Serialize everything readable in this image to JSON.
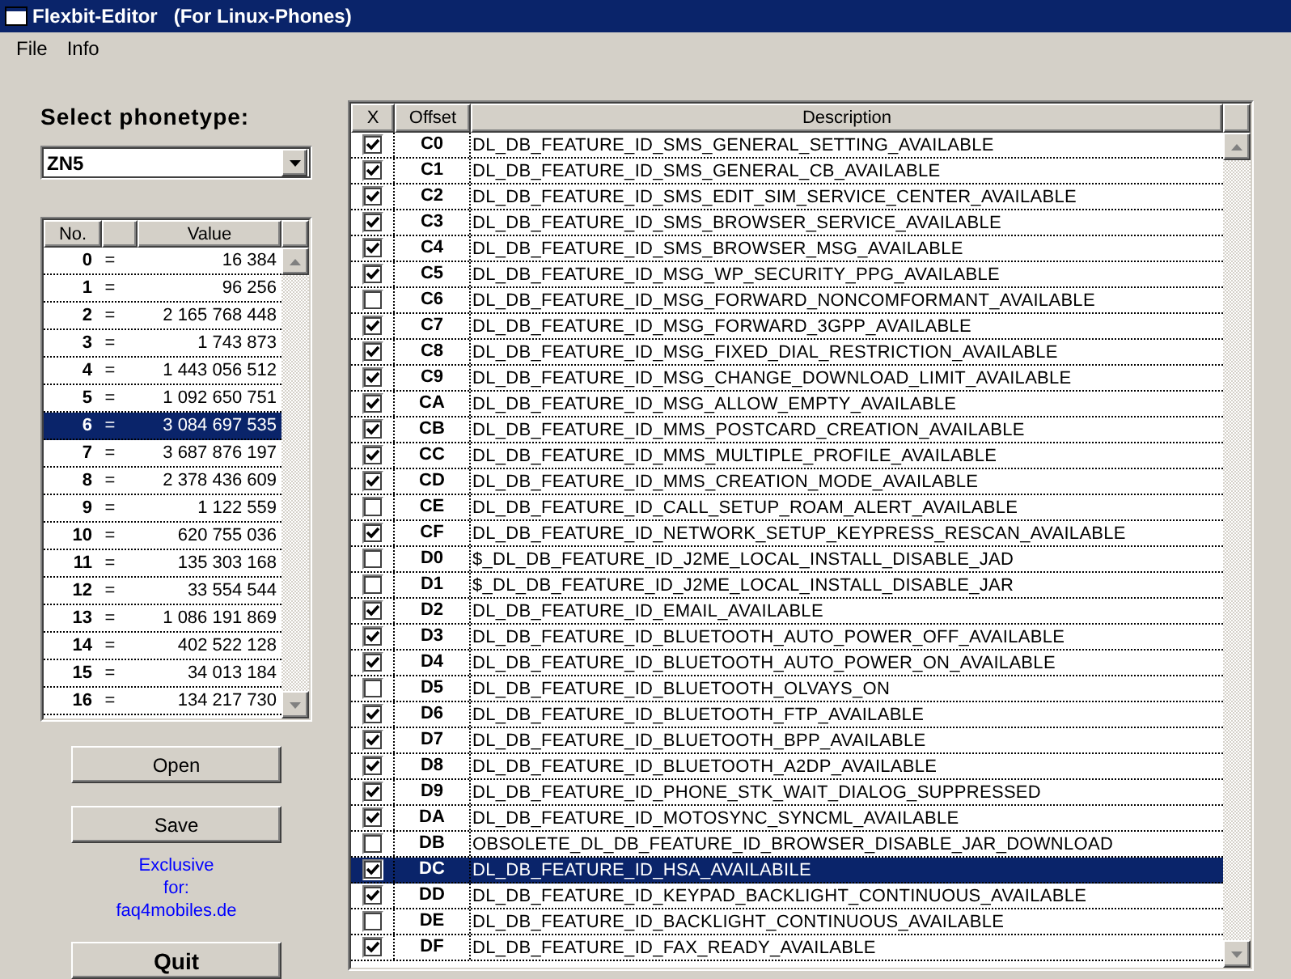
{
  "window": {
    "title": "Flexbit-Editor   (For Linux-Phones)"
  },
  "menu": [
    {
      "label": "File"
    },
    {
      "label": "Info"
    }
  ],
  "phonetype": {
    "label": "Select phonetype:",
    "value": "ZN5"
  },
  "values_table": {
    "columns": [
      "No.",
      "Value"
    ],
    "rows": [
      {
        "no": "0",
        "eq": "=",
        "value": "16 384",
        "selected": false
      },
      {
        "no": "1",
        "eq": "=",
        "value": "96 256",
        "selected": false
      },
      {
        "no": "2",
        "eq": "=",
        "value": "2 165 768 448",
        "selected": false
      },
      {
        "no": "3",
        "eq": "=",
        "value": "1 743 873",
        "selected": false
      },
      {
        "no": "4",
        "eq": "=",
        "value": "1 443 056 512",
        "selected": false
      },
      {
        "no": "5",
        "eq": "=",
        "value": "1 092 650 751",
        "selected": false
      },
      {
        "no": "6",
        "eq": "=",
        "value": "3 084 697 535",
        "selected": true
      },
      {
        "no": "7",
        "eq": "=",
        "value": "3 687 876 197",
        "selected": false
      },
      {
        "no": "8",
        "eq": "=",
        "value": "2 378 436 609",
        "selected": false
      },
      {
        "no": "9",
        "eq": "=",
        "value": "1 122 559",
        "selected": false
      },
      {
        "no": "10",
        "eq": "=",
        "value": "620 755 036",
        "selected": false
      },
      {
        "no": "11",
        "eq": "=",
        "value": "135 303 168",
        "selected": false
      },
      {
        "no": "12",
        "eq": "=",
        "value": "33 554 544",
        "selected": false
      },
      {
        "no": "13",
        "eq": "=",
        "value": "1 086 191 869",
        "selected": false
      },
      {
        "no": "14",
        "eq": "=",
        "value": "402 522 128",
        "selected": false
      },
      {
        "no": "15",
        "eq": "=",
        "value": "34 013 184",
        "selected": false
      },
      {
        "no": "16",
        "eq": "=",
        "value": "134 217 730",
        "selected": false
      }
    ]
  },
  "buttons": [
    {
      "label": "Open"
    },
    {
      "label": "Save"
    }
  ],
  "credit": [
    "Exclusive",
    "for:",
    "faq4mobiles.de"
  ],
  "quit": {
    "label": "Quit"
  },
  "features_table": {
    "columns": [
      "X",
      "Offset",
      "Description"
    ],
    "rows": [
      {
        "checked": true,
        "offset": "C0",
        "description": "DL_DB_FEATURE_ID_SMS_GENERAL_SETTING_AVAILABLE",
        "selected": false
      },
      {
        "checked": true,
        "offset": "C1",
        "description": "DL_DB_FEATURE_ID_SMS_GENERAL_CB_AVAILABLE",
        "selected": false
      },
      {
        "checked": true,
        "offset": "C2",
        "description": "DL_DB_FEATURE_ID_SMS_EDIT_SIM_SERVICE_CENTER_AVAILABLE",
        "selected": false
      },
      {
        "checked": true,
        "offset": "C3",
        "description": "DL_DB_FEATURE_ID_SMS_BROWSER_SERVICE_AVAILABLE",
        "selected": false
      },
      {
        "checked": true,
        "offset": "C4",
        "description": "DL_DB_FEATURE_ID_SMS_BROWSER_MSG_AVAILABLE",
        "selected": false
      },
      {
        "checked": true,
        "offset": "C5",
        "description": "DL_DB_FEATURE_ID_MSG_WP_SECURITY_PPG_AVAILABLE",
        "selected": false
      },
      {
        "checked": false,
        "offset": "C6",
        "description": "DL_DB_FEATURE_ID_MSG_FORWARD_NONCOMFORMANT_AVAILABLE",
        "selected": false
      },
      {
        "checked": true,
        "offset": "C7",
        "description": "DL_DB_FEATURE_ID_MSG_FORWARD_3GPP_AVAILABLE",
        "selected": false
      },
      {
        "checked": true,
        "offset": "C8",
        "description": "DL_DB_FEATURE_ID_MSG_FIXED_DIAL_RESTRICTION_AVAILABLE",
        "selected": false
      },
      {
        "checked": true,
        "offset": "C9",
        "description": "DL_DB_FEATURE_ID_MSG_CHANGE_DOWNLOAD_LIMIT_AVAILABLE",
        "selected": false
      },
      {
        "checked": true,
        "offset": "CA",
        "description": "DL_DB_FEATURE_ID_MSG_ALLOW_EMPTY_AVAILABLE",
        "selected": false
      },
      {
        "checked": true,
        "offset": "CB",
        "description": "DL_DB_FEATURE_ID_MMS_POSTCARD_CREATION_AVAILABLE",
        "selected": false
      },
      {
        "checked": true,
        "offset": "CC",
        "description": "DL_DB_FEATURE_ID_MMS_MULTIPLE_PROFILE_AVAILABLE",
        "selected": false
      },
      {
        "checked": true,
        "offset": "CD",
        "description": "DL_DB_FEATURE_ID_MMS_CREATION_MODE_AVAILABLE",
        "selected": false
      },
      {
        "checked": false,
        "offset": "CE",
        "description": "DL_DB_FEATURE_ID_CALL_SETUP_ROAM_ALERT_AVAILABLE",
        "selected": false
      },
      {
        "checked": true,
        "offset": "CF",
        "description": "DL_DB_FEATURE_ID_NETWORK_SETUP_KEYPRESS_RESCAN_AVAILABLE",
        "selected": false
      },
      {
        "checked": false,
        "offset": "D0",
        "description": "$_DL_DB_FEATURE_ID_J2ME_LOCAL_INSTALL_DISABLE_JAD",
        "selected": false
      },
      {
        "checked": false,
        "offset": "D1",
        "description": "$_DL_DB_FEATURE_ID_J2ME_LOCAL_INSTALL_DISABLE_JAR",
        "selected": false
      },
      {
        "checked": true,
        "offset": "D2",
        "description": "DL_DB_FEATURE_ID_EMAIL_AVAILABLE",
        "selected": false
      },
      {
        "checked": true,
        "offset": "D3",
        "description": "DL_DB_FEATURE_ID_BLUETOOTH_AUTO_POWER_OFF_AVAILABLE",
        "selected": false
      },
      {
        "checked": true,
        "offset": "D4",
        "description": "DL_DB_FEATURE_ID_BLUETOOTH_AUTO_POWER_ON_AVAILABLE",
        "selected": false
      },
      {
        "checked": false,
        "offset": "D5",
        "description": "DL_DB_FEATURE_ID_BLUETOOTH_OLVAYS_ON",
        "selected": false
      },
      {
        "checked": true,
        "offset": "D6",
        "description": "DL_DB_FEATURE_ID_BLUETOOTH_FTP_AVAILABLE",
        "selected": false
      },
      {
        "checked": true,
        "offset": "D7",
        "description": "DL_DB_FEATURE_ID_BLUETOOTH_BPP_AVAILABLE",
        "selected": false
      },
      {
        "checked": true,
        "offset": "D8",
        "description": "DL_DB_FEATURE_ID_BLUETOOTH_A2DP_AVAILABLE",
        "selected": false
      },
      {
        "checked": true,
        "offset": "D9",
        "description": "DL_DB_FEATURE_ID_PHONE_STK_WAIT_DIALOG_SUPPRESSED",
        "selected": false
      },
      {
        "checked": true,
        "offset": "DA",
        "description": "DL_DB_FEATURE_ID_MOTOSYNC_SYNCML_AVAILABLE",
        "selected": false
      },
      {
        "checked": false,
        "offset": "DB",
        "description": "OBSOLETE_DL_DB_FEATURE_ID_BROWSER_DISABLE_JAR_DOWNLOAD",
        "selected": false
      },
      {
        "checked": true,
        "offset": "DC",
        "description": "DL_DB_FEATURE_ID_HSA_AVAILABILE",
        "selected": true
      },
      {
        "checked": true,
        "offset": "DD",
        "description": "DL_DB_FEATURE_ID_KEYPAD_BACKLIGHT_CONTINUOUS_AVAILABLE",
        "selected": false
      },
      {
        "checked": false,
        "offset": "DE",
        "description": "DL_DB_FEATURE_ID_BACKLIGHT_CONTINUOUS_AVAILABLE",
        "selected": false
      },
      {
        "checked": true,
        "offset": "DF",
        "description": "DL_DB_FEATURE_ID_FAX_READY_AVAILABLE",
        "selected": false
      }
    ]
  }
}
